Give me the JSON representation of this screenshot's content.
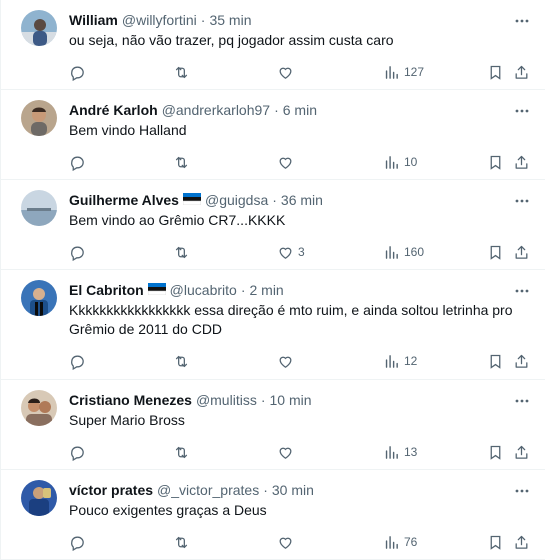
{
  "icons": {
    "more": "more-horizontal-icon",
    "reply": "reply-bubble-icon",
    "retweet": "retweet-icon",
    "like": "heart-icon",
    "views": "views-bar-chart-icon",
    "bookmark": "bookmark-icon",
    "share": "share-upload-icon"
  },
  "colors": {
    "text": "#0f1419",
    "muted": "#536471",
    "divider": "#eff3f4"
  },
  "tweets": [
    {
      "name": "William",
      "handle": "@willyfortini",
      "dot": "·",
      "time": "35 min",
      "text": "ou seja, não vão trazer, pq jogador assim custa caro",
      "likes": "",
      "views": "127",
      "flag": false
    },
    {
      "name": "André Karloh",
      "handle": "@andrerkarloh97",
      "dot": "·",
      "time": "6 min",
      "text": "Bem vindo Halland",
      "likes": "",
      "views": "10",
      "flag": false
    },
    {
      "name": "Guilherme Alves",
      "handle": "@guigdsa",
      "dot": "·",
      "time": "36 min",
      "text": "Bem vindo ao Grêmio CR7...KKKK",
      "likes": "3",
      "views": "160",
      "flag": true
    },
    {
      "name": "El Cabriton",
      "handle": "@lucabrito",
      "dot": "·",
      "time": "2 min",
      "text": "Kkkkkkkkkkkkkkkkk essa direção é mto ruim, e ainda soltou letrinha pro Grêmio de 2011 do CDD",
      "likes": "",
      "views": "12",
      "flag": true
    },
    {
      "name": "Cristiano Menezes",
      "handle": "@mulitiss",
      "dot": "·",
      "time": "10 min",
      "text": "Super Mario Bross",
      "likes": "",
      "views": "13",
      "flag": false
    },
    {
      "name": "víctor prates",
      "handle": "@_victor_prates",
      "dot": "·",
      "time": "30 min",
      "text": "Pouco exigentes graças a Deus",
      "likes": "",
      "views": "76",
      "flag": false
    }
  ]
}
